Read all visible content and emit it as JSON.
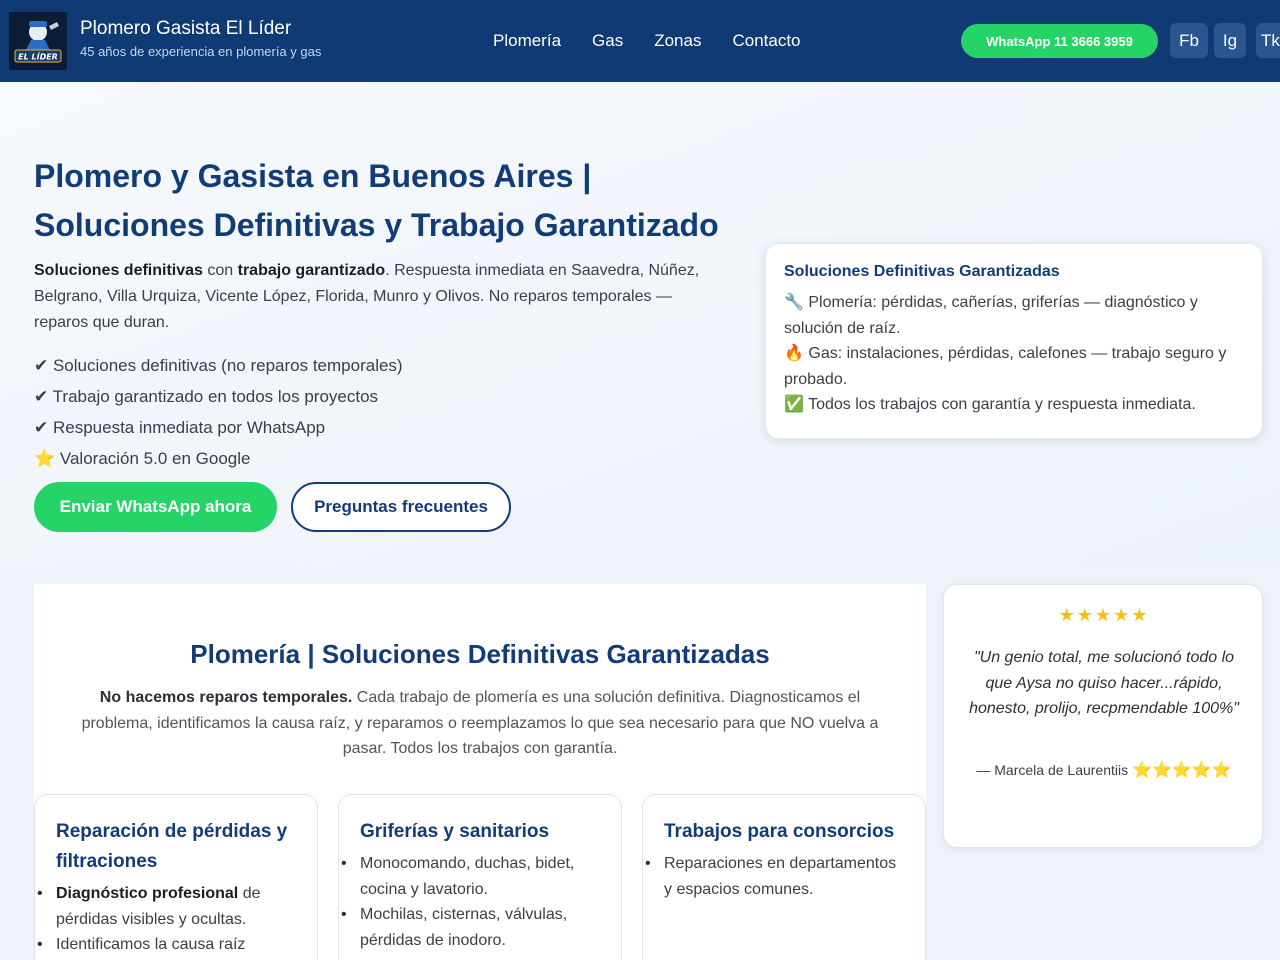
{
  "header": {
    "title": "Plomero Gasista El Líder",
    "subtitle": "45 años de experiencia en plomería y gas",
    "logo_text": "EL LÍDER",
    "nav": [
      "Plomería",
      "Gas",
      "Zonas",
      "Contacto"
    ],
    "whatsapp_label": "WhatsApp 11 3666 3959",
    "social": [
      "Fb",
      "Ig",
      "Tk"
    ]
  },
  "hero": {
    "title": "Plomero y Gasista en Buenos Aires | Soluciones Definitivas y Trabajo Garantizado",
    "intro_bold_1": "Soluciones definitivas",
    "intro_mid_1": " con ",
    "intro_bold_2": "trabajo garantizado",
    "intro_rest": ". Respuesta inmediata en Saavedra, Núñez, Belgrano, Villa Urquiza, Vicente López, Florida, Munro y Olivos. No reparos temporales — reparos que duran.",
    "checks": [
      "✔ Soluciones definitivas (no reparos temporales)",
      "✔ Trabajo garantizado en todos los proyectos",
      "✔ Respuesta inmediata por WhatsApp",
      "⭐ Valoración 5.0 en Google"
    ],
    "btn_whatsapp": "Enviar WhatsApp ahora",
    "btn_faq": "Preguntas frecuentes",
    "card": {
      "title": "Soluciones Definitivas Garantizadas",
      "lines": [
        "🔧 Plomería: pérdidas, cañerías, griferías — diagnóstico y solución de raíz.",
        "🔥 Gas: instalaciones, pérdidas, calefones — trabajo seguro y probado.",
        "✅ Todos los trabajos con garantía y respuesta inmediata."
      ]
    }
  },
  "plumbing": {
    "title": "Plomería | Soluciones Definitivas Garantizadas",
    "intro_bold": "No hacemos reparos temporales.",
    "intro_rest": " Cada trabajo de plomería es una solución definitiva. Diagnosticamos el problema, identificamos la causa raíz, y reparamos o reemplazamos lo que sea necesario para que NO vuelva a pasar. Todos los trabajos con garantía.",
    "services": [
      {
        "title": "Reparación de pérdidas y filtraciones",
        "item1_bold": "Diagnóstico profesional",
        "item1_rest": " de pérdidas visibles y ocultas.",
        "item2": "Identificamos la causa raíz"
      },
      {
        "title": "Griferías y sanitarios",
        "item1": "Monocomando, duchas, bidet, cocina y lavatorio.",
        "item2": "Mochilas, cisternas, válvulas, pérdidas de inodoro."
      },
      {
        "title": "Trabajos para consorcios",
        "item1": "Reparaciones en departamentos y espacios comunes."
      }
    ]
  },
  "review": {
    "stars": "★★★★★",
    "quote": "\"Un genio total, me solucionó todo lo que Aysa no quiso hacer...rápido, honesto, prolijo, recpmendable 100%\"",
    "author": "— Marcela de Laurentiis ",
    "author_stars": "⭐⭐⭐⭐⭐"
  },
  "colors": {
    "header_bg": "#0f3a73",
    "accent_green": "#25d366",
    "heading_blue": "#123c78",
    "star_yellow": "#f4c20d"
  }
}
